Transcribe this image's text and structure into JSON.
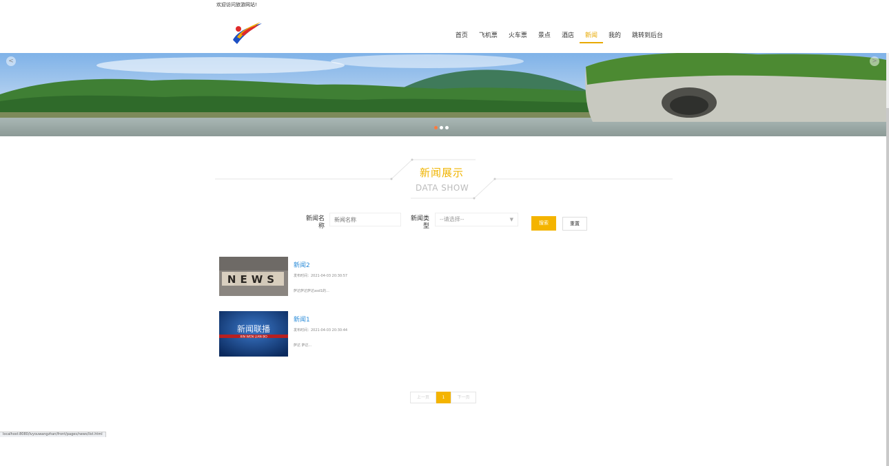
{
  "top_bar": {
    "welcome": "欢迎访问旅游网站!"
  },
  "nav": {
    "items": [
      {
        "label": "首页",
        "active": false
      },
      {
        "label": "飞机票",
        "active": false
      },
      {
        "label": "火车票",
        "active": false
      },
      {
        "label": "景点",
        "active": false
      },
      {
        "label": "酒店",
        "active": false
      },
      {
        "label": "新闻",
        "active": true
      },
      {
        "label": "我的",
        "active": false
      },
      {
        "label": "跳转到后台",
        "active": false
      }
    ]
  },
  "banner": {
    "arrow_prev": "<",
    "arrow_next": ">",
    "slide_count": 3,
    "active_slide": 1
  },
  "section": {
    "title_zh": "新闻展示",
    "title_en": "DATA SHOW"
  },
  "search": {
    "name_label_line1": "新闻名",
    "name_label_line2": "称",
    "name_placeholder": "新闻名称",
    "type_label_line1": "新闻类",
    "type_label_line2": "型",
    "type_selected": "--请选择--",
    "search_button": "搜索",
    "reset_button": "重置"
  },
  "news": [
    {
      "title": "新闻2",
      "time": "发布时间：2021-04-03 20:30:57",
      "desc": "萨达萨达萨达asd1的...",
      "thumb": "NEWS"
    },
    {
      "title": "新闻1",
      "time": "发布时间：2021-04-03 20:30:44",
      "desc": "萨达 萨达...",
      "thumb_zh": "新闻联播",
      "thumb_en": "XIN WEN LIAN BO"
    }
  ],
  "pagination": {
    "prev": "上一页",
    "current": "1",
    "next": "下一页"
  },
  "status_bar": {
    "url": "localhost:8080/lvyouwangzhan/front/pages/news/list.html"
  },
  "colors": {
    "accent": "#f4b400",
    "link": "#2a8bd8"
  }
}
